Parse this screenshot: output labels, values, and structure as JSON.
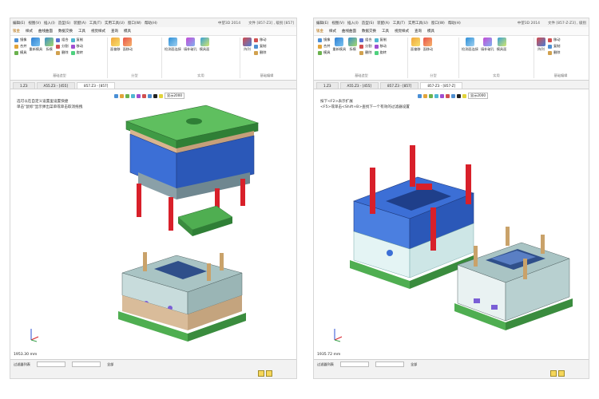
{
  "left": {
    "menus": [
      "编辑(E)",
      "视图(V)",
      "插入(I)",
      "造型(S)",
      "装配(A)",
      "工具(T)",
      "实用工具(U)",
      "窗口(W)",
      "帮助(H)"
    ],
    "app_title": "中望3D 2014",
    "doc_info": "文件 [857-Z3] , 级别 [857]",
    "ribbon_tabs": [
      "钣金",
      "样式",
      "曲线曲面",
      "数据交换",
      "工具",
      "视觉样式",
      "查询",
      "模具"
    ],
    "groups": {
      "g1_items": [
        "镜像",
        "合并",
        "模具"
      ],
      "g1_big": [
        "重新模具",
        "拆模"
      ],
      "g1_small": [
        "组合",
        "分割",
        "删除",
        "复制",
        "移动",
        "旋转"
      ],
      "g1_name": "基础造型",
      "g2_items": [
        "面偏移",
        "面移动"
      ],
      "g2_name": "分型",
      "g3_items": [
        "检测面连接",
        "填补破孔",
        "模具面"
      ],
      "g3_name": "实用",
      "g4_items": [
        "阵列"
      ],
      "g4_small": [
        "移动",
        "复制",
        "删除"
      ],
      "g4_name": "基础编辑"
    },
    "doc_tabs": [
      "1.Z3",
      "A55.Z3 - [455]",
      "857.Z3 - [857]"
    ],
    "view_label": "显示2000",
    "hint": [
      "选可以在自定义设置里设置快捷",
      "单击\"鼠标\"显示弹出菜单或单击取消拖拽"
    ],
    "scale": "1953.30 mm",
    "status_label": "过滤器列表",
    "status_select": "全部"
  },
  "right": {
    "menus": [
      "编辑(E)",
      "视图(V)",
      "插入(I)",
      "造型(S)",
      "装配(A)",
      "工具(T)",
      "实用工具(U)",
      "窗口(W)",
      "帮助(H)"
    ],
    "app_title": "中望3D 2014",
    "doc_info": "文件 [857-Z-Z3] , 级别",
    "ribbon_tabs": [
      "钣金",
      "样式",
      "曲线曲面",
      "数据交换",
      "工具",
      "视觉样式",
      "查询",
      "模具"
    ],
    "groups": {
      "g1_items": [
        "镜像",
        "合并",
        "模具"
      ],
      "g1_big": [
        "重新模具",
        "拆模"
      ],
      "g1_small": [
        "组合",
        "分割",
        "删除",
        "复制",
        "移动",
        "旋转"
      ],
      "g1_name": "基础造型",
      "g2_items": [
        "面偏移",
        "面移动"
      ],
      "g2_name": "分型",
      "g3_items": [
        "检测面连接",
        "填补破孔",
        "模具面"
      ],
      "g3_name": "实用",
      "g4_items": [
        "阵列"
      ],
      "g4_small": [
        "移动",
        "复制",
        "删除"
      ],
      "g4_name": "基础编辑"
    },
    "doc_tabs": [
      "1.Z3",
      "A55.Z3 - [455]",
      "857.Z3 - [857]",
      "857-Z3 - [857-Z]"
    ],
    "view_label": "显示2000",
    "hint": [
      "按下<F2>表示扩展",
      "<F5>或单击<Shift+B>查找下一个有效的过滤器设置"
    ],
    "scale": "1935.72 mm",
    "status_label": "过滤器列表",
    "status_select": "全部"
  },
  "colors": {
    "green_plate": "#3f9a45",
    "blue_plate": "#3c6fd6",
    "grey_block": "#a9c4c4",
    "pillar_red": "#d8202a",
    "pale_cyan": "#e4f4f4"
  }
}
